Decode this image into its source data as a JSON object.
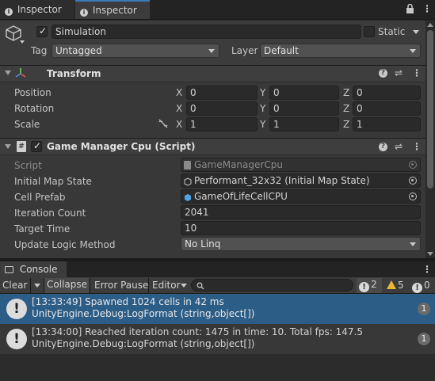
{
  "tabs": [
    {
      "label": "Inspector",
      "icon": "info-icon"
    },
    {
      "label": "Inspector",
      "icon": "info-icon"
    }
  ],
  "object": {
    "name": "Simulation",
    "static_label": "Static",
    "tag_label": "Tag",
    "tag_value": "Untagged",
    "layer_label": "Layer",
    "layer_value": "Default"
  },
  "transform": {
    "title": "Transform",
    "rows": [
      {
        "label": "Position",
        "x": "0",
        "y": "0",
        "z": "0"
      },
      {
        "label": "Rotation",
        "x": "0",
        "y": "0",
        "z": "0"
      },
      {
        "label": "Scale",
        "x": "1",
        "y": "1",
        "z": "1"
      }
    ],
    "axes": {
      "x": "X",
      "y": "Y",
      "z": "Z"
    }
  },
  "script_component": {
    "title": "Game Manager Cpu (Script)",
    "fields": {
      "script": {
        "label": "Script",
        "value": "GameManagerCpu"
      },
      "initial_map_state": {
        "label": "Initial Map State",
        "value": "Performant_32x32 (Initial Map State)"
      },
      "cell_prefab": {
        "label": "Cell Prefab",
        "value": "GameOfLifeCellCPU"
      },
      "iteration_count": {
        "label": "Iteration Count",
        "value": "2041"
      },
      "target_time": {
        "label": "Target Time",
        "value": "10"
      },
      "update_logic_method": {
        "label": "Update Logic Method",
        "value": "No Linq"
      }
    }
  },
  "console": {
    "tab_label": "Console",
    "toolbar": {
      "clear": "Clear",
      "collapse": "Collapse",
      "error_pause": "Error Pause",
      "editor": "Editor",
      "search_placeholder": "",
      "log_count": "2",
      "warn_count": "5",
      "error_count": "0"
    },
    "entries": [
      {
        "line1": "[13:33:49] Spawned 1024 cells in 42 ms",
        "line2": "UnityEngine.Debug:LogFormat (string,object[])",
        "count": "1",
        "selected": true
      },
      {
        "line1": "[13:34:00] Reached iteration count: 1475 in time: 10. Total fps: 147.5",
        "line2": "UnityEngine.Debug:LogFormat (string,object[])",
        "count": "1",
        "selected": false
      }
    ]
  },
  "colors": {
    "selected_row": "#2c5d87",
    "header_bg": "#3e3e3e",
    "panel_bg": "#383838"
  }
}
